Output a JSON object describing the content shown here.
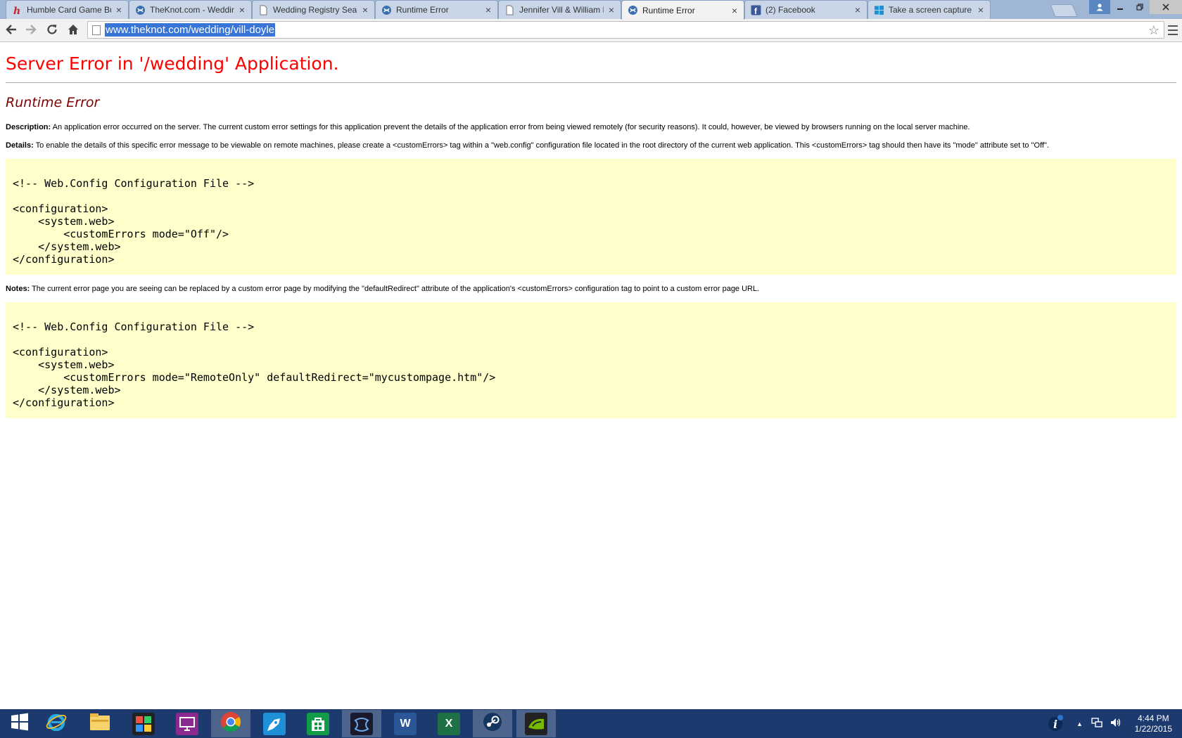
{
  "tabs": [
    {
      "label": "Humble Card Game Bun",
      "icon": "humble-icon"
    },
    {
      "label": "TheKnot.com - Wedding",
      "icon": "theknot-icon"
    },
    {
      "label": "Wedding Registry Search",
      "icon": "page-icon"
    },
    {
      "label": "Runtime Error",
      "icon": "theknot-icon"
    },
    {
      "label": "Jennifer Vill & William D",
      "icon": "page-icon"
    },
    {
      "label": "Runtime Error",
      "icon": "theknot-icon",
      "active": true
    },
    {
      "label": "(2) Facebook",
      "icon": "facebook-icon"
    },
    {
      "label": "Take a screen capture (p",
      "icon": "windows-icon"
    }
  ],
  "toolbar": {
    "url": "www.theknot.com/wedding/vill-doyle"
  },
  "page": {
    "title": "Server Error in '/wedding' Application.",
    "subtitle": "Runtime Error",
    "description_label": "Description:",
    "description_text": " An application error occurred on the server. The current custom error settings for this application prevent the details of the application error from being viewed remotely (for security reasons). It could, however, be viewed by browsers running on the local server machine.",
    "details_label": "Details:",
    "details_text": " To enable the details of this specific error message to be viewable on remote machines, please create a <customErrors> tag within a \"web.config\" configuration file located in the root directory of the current web application. This <customErrors> tag should then have its \"mode\" attribute set to \"Off\".",
    "code1": "<!-- Web.Config Configuration File -->\n\n<configuration>\n    <system.web>\n        <customErrors mode=\"Off\"/>\n    </system.web>\n</configuration>",
    "notes_label": "Notes:",
    "notes_text": " The current error page you are seeing can be replaced by a custom error page by modifying the \"defaultRedirect\" attribute of the application's <customErrors> configuration tag to point to a custom error page URL.",
    "code2": "<!-- Web.Config Configuration File -->\n\n<configuration>\n    <system.web>\n        <customErrors mode=\"RemoteOnly\" defaultRedirect=\"mycustompage.htm\"/>\n    </system.web>\n</configuration>"
  },
  "taskbar": {
    "apps": [
      {
        "name": "start",
        "icon": "windows-start-icon"
      },
      {
        "name": "internet-explorer",
        "icon": "ie-icon"
      },
      {
        "name": "file-explorer",
        "icon": "folder-icon"
      },
      {
        "name": "photo-app",
        "icon": "photo-app-icon"
      },
      {
        "name": "remote-app",
        "icon": "remote-app-icon"
      },
      {
        "name": "chrome",
        "icon": "chrome-icon",
        "running": true
      },
      {
        "name": "rocket-app",
        "icon": "rocket-icon"
      },
      {
        "name": "store",
        "icon": "store-icon"
      },
      {
        "name": "visual-studio",
        "icon": "vs-icon",
        "running": true
      },
      {
        "name": "word",
        "icon": "word-icon",
        "glyph": "W"
      },
      {
        "name": "excel",
        "icon": "excel-icon",
        "glyph": "X"
      },
      {
        "name": "steam",
        "icon": "steam-icon",
        "running": true
      },
      {
        "name": "nvidia",
        "icon": "nvidia-icon",
        "running": true
      }
    ],
    "time": "4:44 PM",
    "date": "1/22/2015"
  },
  "colors": {
    "error_title": "#ff0000",
    "subtitle": "#800000",
    "code_bg": "#ffffcc",
    "taskbar": "#1c3a6e",
    "selection": "#3875d7"
  }
}
